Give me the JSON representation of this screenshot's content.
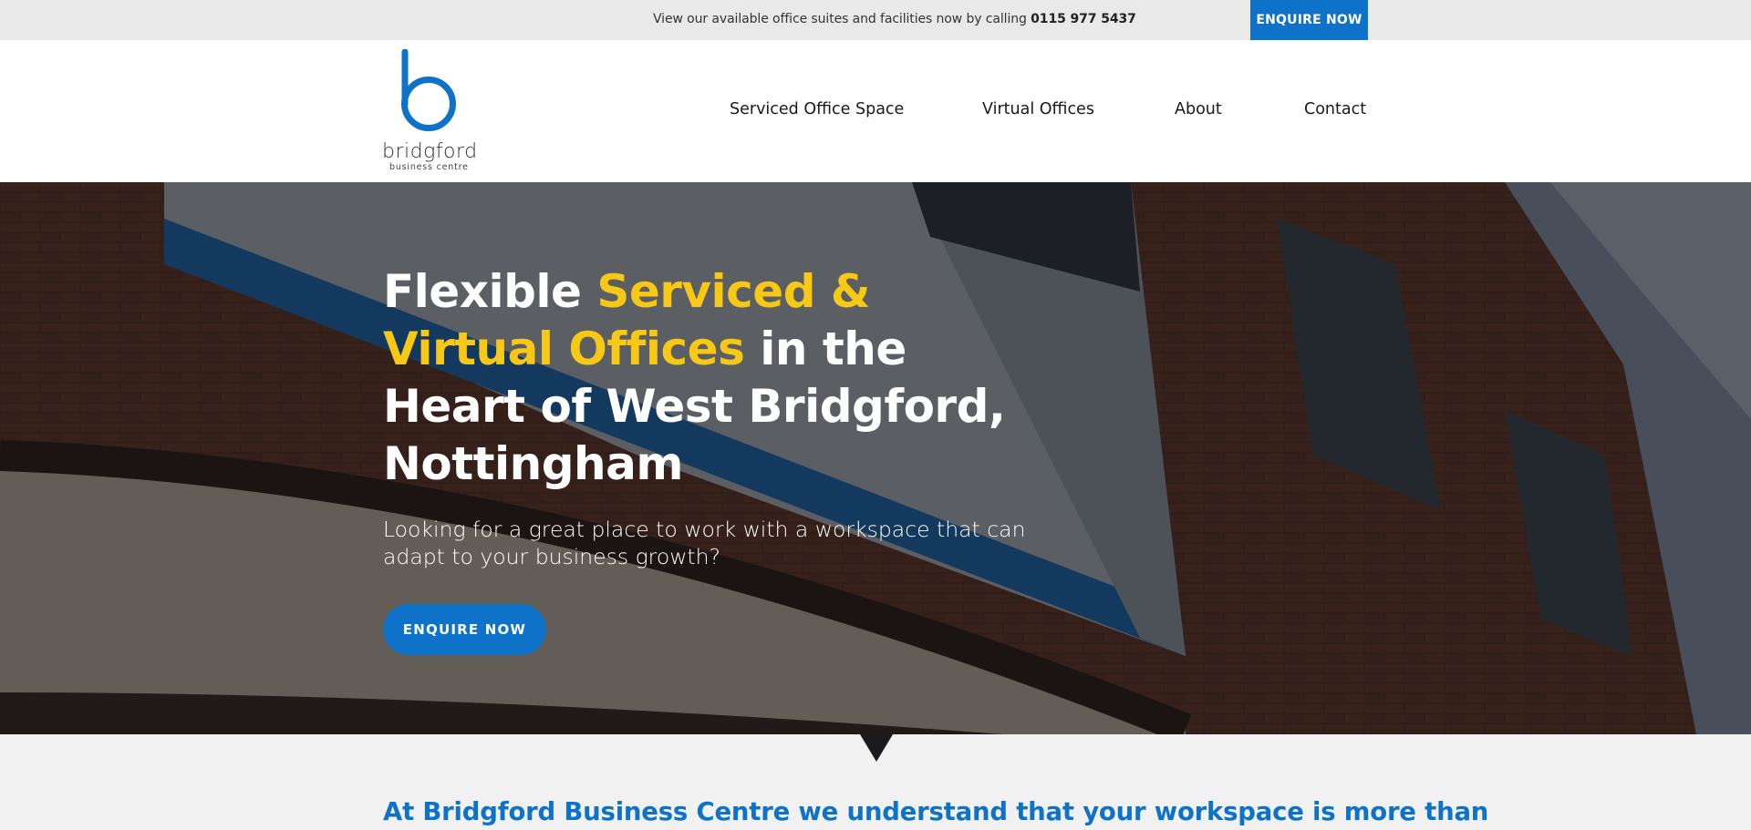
{
  "topbar": {
    "message": "View our available office suites and facilities now by calling ",
    "phone": "0115 977 5437",
    "button_label": "ENQUIRE NOW"
  },
  "logo": {
    "wordmark": "bridgford",
    "subline": "business centre",
    "brand_color": "#0e72c9"
  },
  "nav": {
    "items": [
      {
        "label": "Serviced Office Space"
      },
      {
        "label": "Virtual Offices"
      },
      {
        "label": "About"
      },
      {
        "label": "Contact"
      }
    ]
  },
  "hero": {
    "title_part1": "Flexible ",
    "title_highlight": "Serviced & Virtual Offices",
    "title_part2": " in the Heart of West Bridgford, Nottingham",
    "subtitle": "Looking for a great place to work with a workspace that can adapt to your business growth?",
    "button_label": "ENQUIRE NOW",
    "highlight_color": "#f7c815"
  },
  "intro": {
    "heading": "At Bridgford Business Centre we understand that your workspace is more than"
  }
}
